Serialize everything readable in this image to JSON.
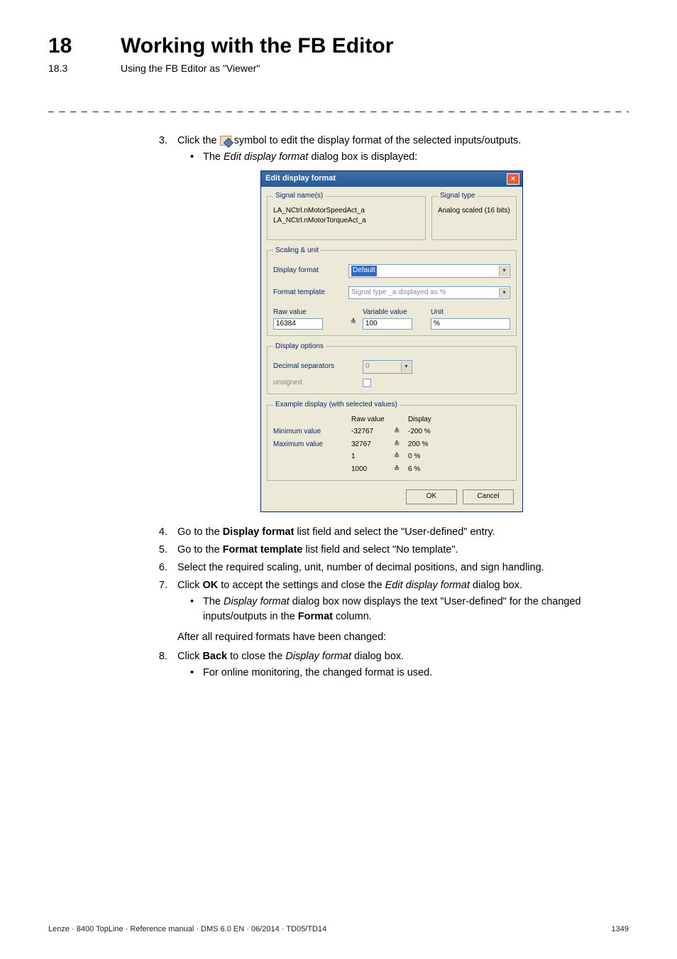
{
  "header": {
    "chapter_num": "18",
    "chapter_title": "Working with the FB Editor",
    "sub_num": "18.3",
    "sub_title": "Using the FB Editor as \"Viewer\""
  },
  "dashes": "_ _ _ _ _ _ _ _ _ _ _ _ _ _ _ _ _ _ _ _ _ _ _ _ _ _ _ _ _ _ _ _ _ _ _ _ _ _ _ _ _ _ _ _ _ _ _ _ _ _ _ _ _ _ _ _ _ _ _ _ _ _ _ _",
  "steps": {
    "s3": {
      "num": "3.",
      "pre": "Click the ",
      "post": " symbol to edit the display format of the selected inputs/outputs.",
      "bullet_pre": "The ",
      "bullet_italic": "Edit display format",
      "bullet_post": " dialog box is displayed:"
    },
    "s4": {
      "num": "4.",
      "pre": "Go to the ",
      "b": "Display format",
      "post": " list field and select the \"User-defined\" entry."
    },
    "s5": {
      "num": "5.",
      "pre": "Go to the ",
      "b": "Format template",
      "post": " list field and select \"No template\"."
    },
    "s6": {
      "num": "6.",
      "text": "Select the required scaling, unit, number of decimal positions, and sign handling."
    },
    "s7": {
      "num": "7.",
      "pre": "Click ",
      "b": "OK",
      "mid": " to accept the settings and close the ",
      "i": "Edit display format",
      "post": " dialog box.",
      "bullet_pre": "The ",
      "bullet_i": "Display format",
      "bullet_mid": " dialog box now displays the text \"User-defined\" for the changed inputs/outputs in the ",
      "bullet_b": "Format",
      "bullet_post": " column."
    },
    "after7": "After all required formats have been changed:",
    "s8": {
      "num": "8.",
      "pre": "Click ",
      "b": "Back",
      "mid": " to close the ",
      "i": "Display format",
      "post": " dialog box.",
      "bullet": "For online monitoring, the changed format is used."
    }
  },
  "dialog": {
    "title": "Edit display format",
    "signal_legend": "Signal name(s)",
    "signal1": "LA_NCtrl.nMotorSpeedAct_a",
    "signal2": "LA_NCtrl.nMotorTorqueAct_a",
    "sigtype_legend": "Signal type",
    "sigtype_val": "Analog scaled (16 bits)",
    "scaling_legend": "Scaling & unit",
    "display_format_lbl": "Display format",
    "display_format_val": "Default",
    "format_template_lbl": "Format template",
    "format_template_val": "Signal type _a displayed as %",
    "raw_value_lbl": "Raw value",
    "raw_value_val": "16384",
    "corresponds": "≙",
    "variable_value_lbl": "Variable value",
    "variable_value_val": "100",
    "unit_lbl": "Unit",
    "unit_val": "%",
    "dispopt_legend": "Display options",
    "decsep_lbl": "Decimal separators",
    "decsep_val": "0",
    "unsigned_lbl": "unsigned",
    "example_legend": "Example display (with selected values)",
    "ex_raw_hdr": "Raw value",
    "ex_disp_hdr": "Display",
    "ex_min_lbl": "Minimum value",
    "ex_max_lbl": "Maximum value",
    "ex_r1": "-32767",
    "ex_d1": "-200 %",
    "ex_r2": "32767",
    "ex_d2": "200 %",
    "ex_r3": "1",
    "ex_d3": "0 %",
    "ex_r4": "1000",
    "ex_d4": "6 %",
    "ok": "OK",
    "cancel": "Cancel"
  },
  "footer": {
    "left": "Lenze · 8400 TopLine · Reference manual · DMS 6.0 EN · 06/2014 · TD05/TD14",
    "right": "1349"
  }
}
